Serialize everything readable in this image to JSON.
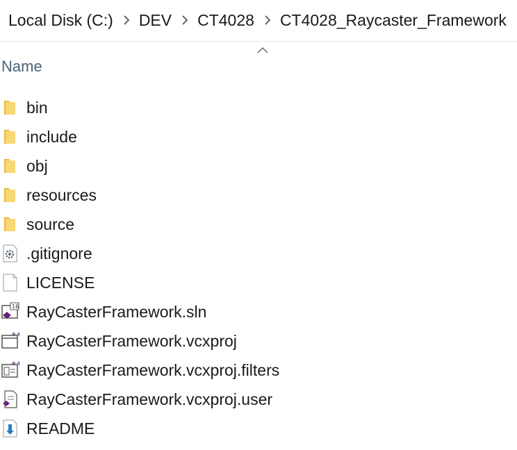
{
  "breadcrumb": [
    "Local Disk (C:)",
    "DEV",
    "CT4028",
    "CT4028_Raycaster_Framework"
  ],
  "columns": {
    "name": "Name"
  },
  "items": [
    {
      "name": "bin",
      "icon": "folder-icon"
    },
    {
      "name": "include",
      "icon": "folder-icon"
    },
    {
      "name": "obj",
      "icon": "folder-icon"
    },
    {
      "name": "resources",
      "icon": "folder-icon"
    },
    {
      "name": "source",
      "icon": "folder-icon"
    },
    {
      "name": ".gitignore",
      "icon": "settings-file-icon"
    },
    {
      "name": "LICENSE",
      "icon": "blank-file-icon"
    },
    {
      "name": "RayCasterFramework.sln",
      "icon": "vs-solution-icon"
    },
    {
      "name": "RayCasterFramework.vcxproj",
      "icon": "vcxproj-icon"
    },
    {
      "name": "RayCasterFramework.vcxproj.filters",
      "icon": "vcxproj-filters-icon"
    },
    {
      "name": "RayCasterFramework.vcxproj.user",
      "icon": "vcxproj-user-icon"
    },
    {
      "name": "README",
      "icon": "readme-file-icon"
    }
  ],
  "colors": {
    "folder": "#f8d775",
    "folder_dark": "#e8b83d",
    "vs_purple": "#68217a",
    "header_text": "#4c607a"
  }
}
